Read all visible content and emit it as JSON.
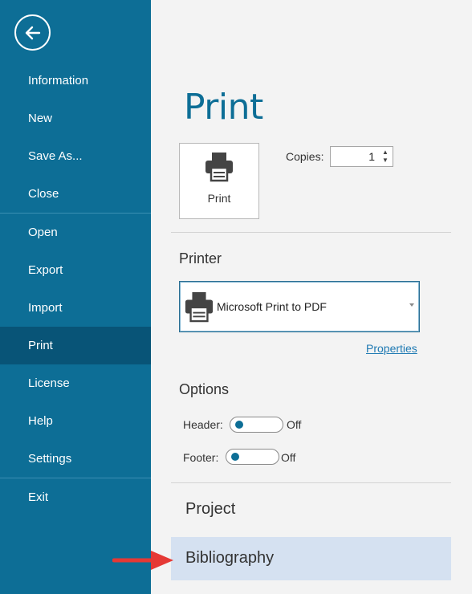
{
  "sidebar": {
    "back_icon": "arrow-left-icon",
    "items": [
      {
        "label": "Information"
      },
      {
        "label": "New"
      },
      {
        "label": "Save As..."
      },
      {
        "label": "Close"
      },
      {
        "label": "Open"
      },
      {
        "label": "Export"
      },
      {
        "label": "Import"
      },
      {
        "label": "Print",
        "active": true
      },
      {
        "label": "License"
      },
      {
        "label": "Help"
      },
      {
        "label": "Settings"
      },
      {
        "label": "Exit"
      }
    ]
  },
  "main": {
    "title": "Print",
    "print_button_label": "Print",
    "copies": {
      "label": "Copies:",
      "value": "1"
    },
    "printer": {
      "heading": "Printer",
      "selected": "Microsoft Print to PDF",
      "properties_link": "Properties"
    },
    "options": {
      "heading": "Options",
      "header": {
        "label": "Header:",
        "state": "Off"
      },
      "footer": {
        "label": "Footer:",
        "state": "Off"
      }
    },
    "targets": {
      "project": "Project",
      "bibliography": "Bibliography"
    }
  },
  "colors": {
    "sidebar": "#0d6e96",
    "sidebar_active": "#085477",
    "title": "#0d6e96",
    "selected_row": "#d5e1f1",
    "arrow": "#e53935"
  }
}
